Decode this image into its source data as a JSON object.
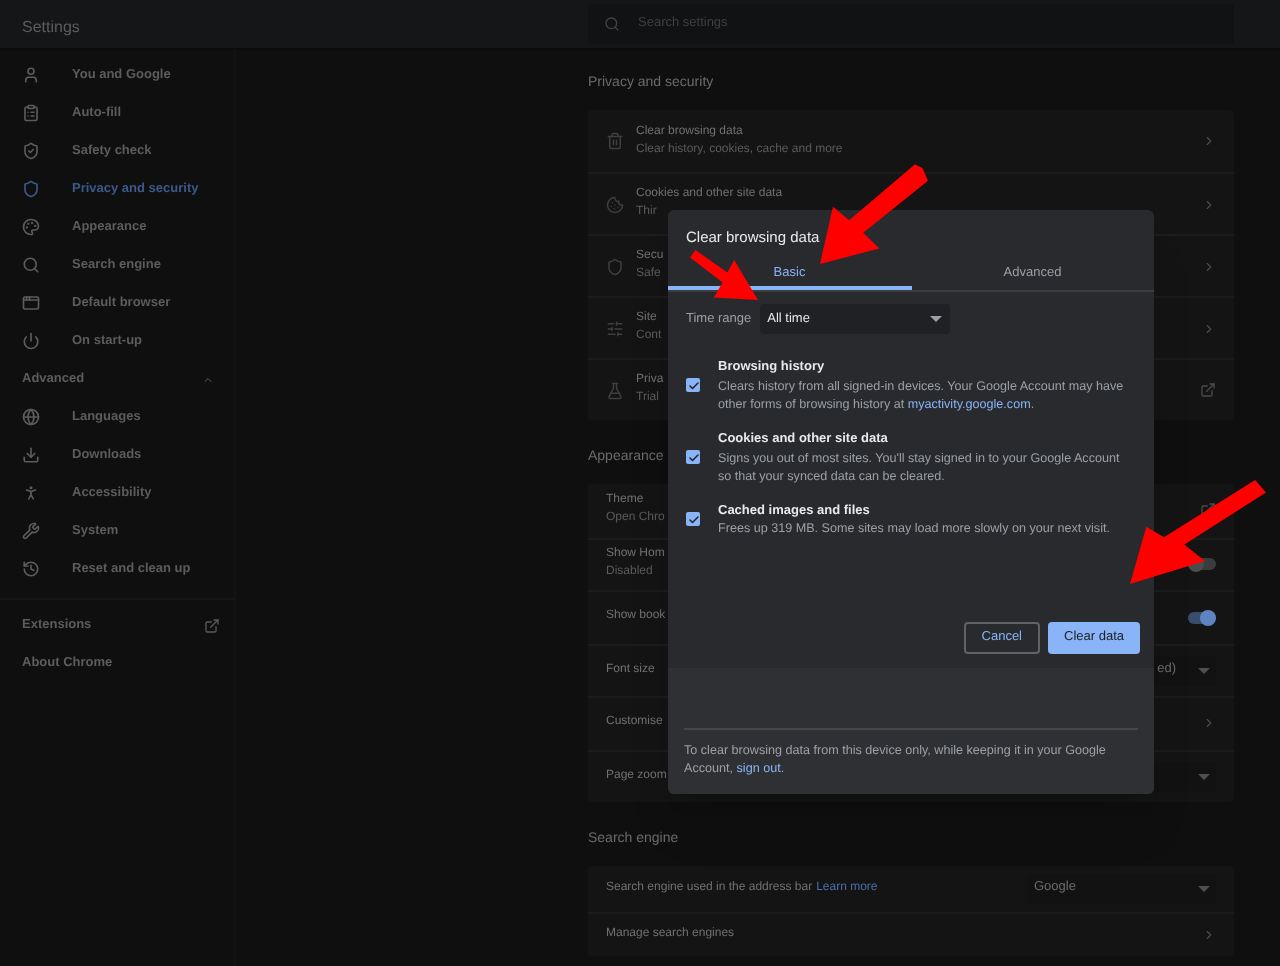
{
  "header": {
    "title": "Settings",
    "search_placeholder": "Search settings"
  },
  "sidebar": {
    "items": [
      {
        "label": "You and Google",
        "selected": false
      },
      {
        "label": "Auto-fill",
        "selected": false
      },
      {
        "label": "Safety check",
        "selected": false
      },
      {
        "label": "Privacy and security",
        "selected": true
      },
      {
        "label": "Appearance",
        "selected": false
      },
      {
        "label": "Search engine",
        "selected": false
      },
      {
        "label": "Default browser",
        "selected": false
      },
      {
        "label": "On start-up",
        "selected": false
      }
    ],
    "advanced": {
      "label": "Advanced",
      "expanded": true,
      "items": [
        {
          "label": "Languages",
          "selected": false
        },
        {
          "label": "Downloads",
          "selected": false
        },
        {
          "label": "Accessibility",
          "selected": false
        },
        {
          "label": "System",
          "selected": false
        },
        {
          "label": "Reset and clean up",
          "selected": false
        }
      ]
    },
    "footer": [
      {
        "label": "Extensions",
        "kind": "external"
      },
      {
        "label": "About Chrome",
        "kind": "plain"
      }
    ]
  },
  "sections": [
    {
      "title": "Privacy and security",
      "rows": [
        {
          "title": "Clear browsing data",
          "subtitle": "Clear history, cookies, cache and more",
          "kind": "chevron"
        },
        {
          "title": "Cookies and other site data",
          "subtitle": "Thir",
          "kind": "chevron"
        },
        {
          "title": "Secu",
          "subtitle": "Safe",
          "kind": "chevron"
        },
        {
          "title": "Site",
          "subtitle": "Cont",
          "kind": "chevron"
        },
        {
          "title": "Priva",
          "subtitle": "Trial",
          "kind": "external"
        }
      ]
    },
    {
      "title": "Appearance",
      "rows": [
        {
          "title": "Theme",
          "subtitle": "Open Chro",
          "kind": "external"
        },
        {
          "title": "Show Hom",
          "subtitle": "Disabled",
          "kind": "toggle",
          "on": false
        },
        {
          "title": "Show book",
          "kind": "toggle",
          "on": true
        },
        {
          "title": "Font size",
          "kind": "select",
          "value": "ed)"
        },
        {
          "title": "Customise",
          "kind": "chevron"
        },
        {
          "title": "Page zoom",
          "kind": "select"
        }
      ]
    },
    {
      "title": "Search engine",
      "rows": [
        {
          "title": "Search engine used in the address bar",
          "link": "Learn more",
          "kind": "select",
          "value": "Google"
        },
        {
          "title": "Manage search engines",
          "kind": "chevron"
        }
      ]
    }
  ],
  "dialog": {
    "title": "Clear browsing data",
    "tabs": [
      {
        "label": "Basic",
        "selected": true
      },
      {
        "label": "Advanced",
        "selected": false
      }
    ],
    "time_range": {
      "label": "Time range",
      "value": "All time"
    },
    "options": [
      {
        "title": "Browsing history",
        "description": "Clears history from all signed-in devices. Your Google Account may have other forms of browsing history at",
        "link": "myactivity.google.com",
        "end": ".",
        "checked": true
      },
      {
        "title": "Cookies and other site data",
        "description": "Signs you out of most sites. You'll stay signed in to your Google Account so that your synced data can be cleared.",
        "checked": true
      },
      {
        "title": "Cached images and files",
        "description": "Frees up 319 MB. Some sites may load more slowly on your next visit.",
        "checked": true
      }
    ],
    "buttons": [
      {
        "label": "Cancel",
        "kind": "secondary"
      },
      {
        "label": "Clear data",
        "kind": "primary"
      }
    ],
    "footer": {
      "text": "To clear browsing data from this device only, while keeping it in your Google Account,",
      "link": "sign out",
      "end": "."
    }
  }
}
